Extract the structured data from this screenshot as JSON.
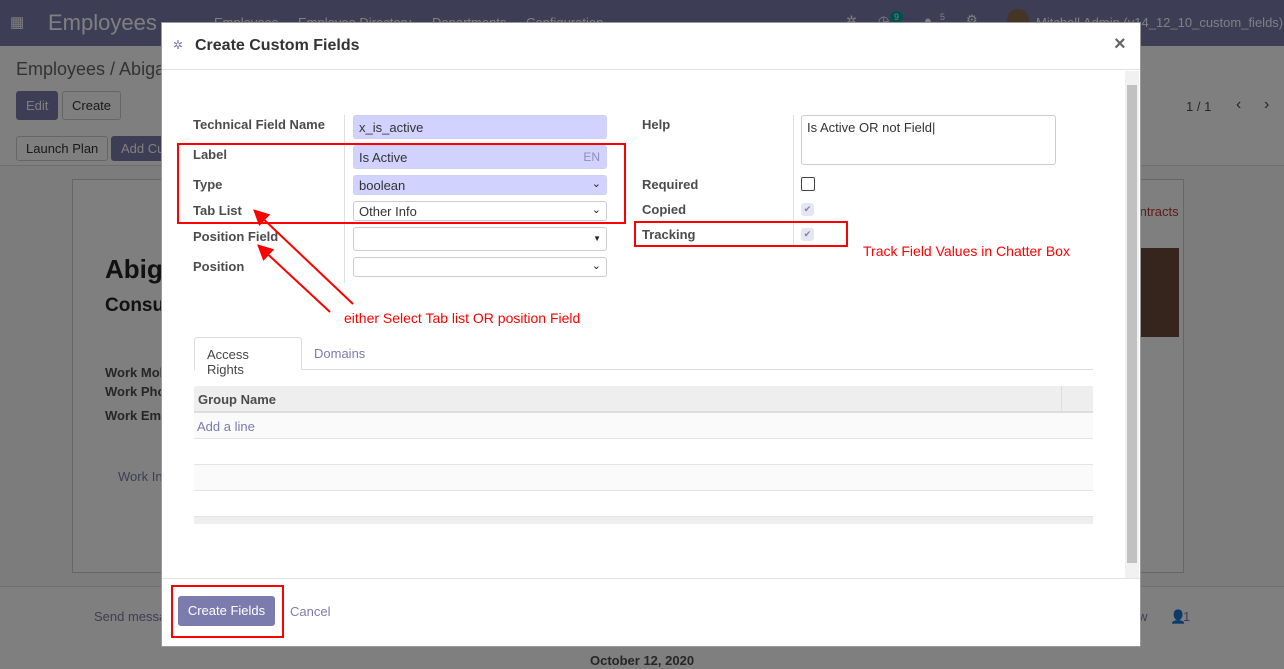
{
  "navbar": {
    "app_title": "Employees",
    "menu": [
      "Employees",
      "Employee Directory",
      "Departments",
      "Configuration"
    ],
    "activity_count": "9",
    "message_count": "5",
    "user": "Mitchell Admin (v14_12_10_custom_fields)"
  },
  "control_panel": {
    "breadcrumb": "Employees / Abigail Peterson",
    "edit": "Edit",
    "create": "Create",
    "pager": "1 / 1",
    "launch_plan": "Launch Plan",
    "add_custom": "Add Custom Fields"
  },
  "sheet": {
    "name": "Abigail Peterson",
    "job": "Consultant",
    "fields": [
      "Work Mobile",
      "Work Phone",
      "Work Email"
    ],
    "tab": "Work Information",
    "contracts": "Contracts"
  },
  "chatter": {
    "send_message": "Send message",
    "follow": "Follow",
    "followers": "1",
    "date": "October 12, 2020"
  },
  "modal": {
    "title": "Create Custom Fields",
    "close": "×",
    "fields": {
      "technical_name": {
        "label": "Technical Field Name",
        "value": "x_is_active"
      },
      "label": {
        "label": "Label",
        "value": "Is Active",
        "lang": "EN"
      },
      "type": {
        "label": "Type",
        "value": "boolean"
      },
      "tab_list": {
        "label": "Tab List",
        "value": "Other Info"
      },
      "position_field": {
        "label": "Position Field",
        "value": ""
      },
      "position": {
        "label": "Position",
        "value": ""
      },
      "help": {
        "label": "Help",
        "value": "Is Active OR not Field"
      },
      "required": {
        "label": "Required",
        "checked": false
      },
      "copied": {
        "label": "Copied",
        "checked": true
      },
      "tracking": {
        "label": "Tracking",
        "checked": true
      }
    },
    "tabs": [
      "Access Rights",
      "Domains"
    ],
    "table": {
      "header": "Group Name",
      "add_line": "Add a line"
    },
    "create_button": "Create Fields",
    "cancel_button": "Cancel"
  },
  "annotations": {
    "tab_or_position": "either Select Tab list OR position Field",
    "tracking_note": "Track Field Values in Chatter Box"
  }
}
